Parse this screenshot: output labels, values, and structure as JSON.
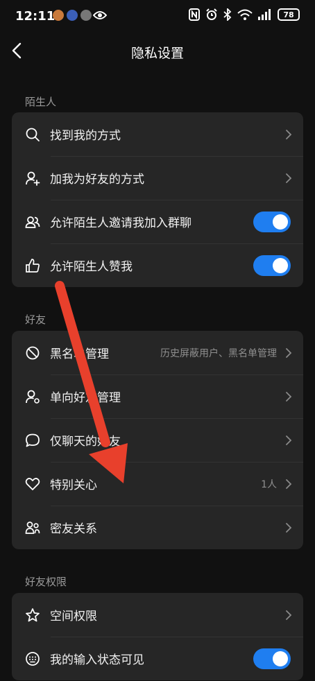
{
  "status_bar": {
    "time": "12:11",
    "battery": "78"
  },
  "header": {
    "title": "隐私设置"
  },
  "sections": {
    "strangers": {
      "label": "陌生人",
      "rows": [
        {
          "label": "找到我的方式",
          "control": "chevron"
        },
        {
          "label": "加我为好友的方式",
          "control": "chevron"
        },
        {
          "label": "允许陌生人邀请我加入群聊",
          "control": "toggle",
          "on": true
        },
        {
          "label": "允许陌生人赞我",
          "control": "toggle",
          "on": true
        }
      ]
    },
    "friends": {
      "label": "好友",
      "rows": [
        {
          "label": "黑名单管理",
          "value": "历史屏蔽用户、黑名单管理",
          "control": "chevron"
        },
        {
          "label": "单向好友管理",
          "control": "chevron"
        },
        {
          "label": "仅聊天的好友",
          "control": "chevron"
        },
        {
          "label": "特别关心",
          "value": "1人",
          "control": "chevron"
        },
        {
          "label": "密友关系",
          "control": "chevron"
        }
      ]
    },
    "friend_permissions": {
      "label": "好友权限",
      "rows": [
        {
          "label": "空间权限",
          "control": "chevron"
        },
        {
          "label": "我的输入状态可见",
          "control": "toggle",
          "on": true
        }
      ]
    }
  },
  "colors": {
    "background": "#111111",
    "card": "#262626",
    "toggle_on": "#1f7ef0",
    "annotation_arrow": "#e8402c"
  }
}
